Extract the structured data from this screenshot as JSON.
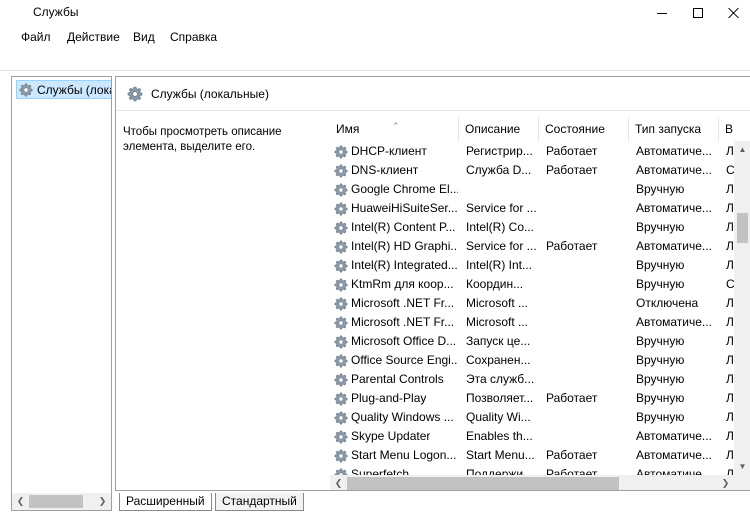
{
  "window": {
    "title": "Службы"
  },
  "menu": {
    "file": "Файл",
    "action": "Действие",
    "view": "Вид",
    "help": "Справка"
  },
  "tree": {
    "selected_label": "Службы (локальные)"
  },
  "pane": {
    "title": "Службы (локальные)",
    "description": "Чтобы просмотреть описание элемента, выделите его."
  },
  "columns": {
    "name": "Имя",
    "description": "Описание",
    "state": "Состояние",
    "startup": "Тип запуска",
    "last": "В"
  },
  "services": [
    {
      "name": "DHCP-клиент",
      "description": "Регистрир...",
      "state": "Работает",
      "startup": "Автоматиче...",
      "last": "Л"
    },
    {
      "name": "DNS-клиент",
      "description": "Служба D...",
      "state": "Работает",
      "startup": "Автоматиче...",
      "last": "С"
    },
    {
      "name": "Google Chrome El...",
      "description": "",
      "state": "",
      "startup": "Вручную",
      "last": "Л"
    },
    {
      "name": "HuaweiHiSuiteSer...",
      "description": "Service for ...",
      "state": "",
      "startup": "Автоматиче...",
      "last": "Л"
    },
    {
      "name": "Intel(R) Content P...",
      "description": "Intel(R) Co...",
      "state": "",
      "startup": "Вручную",
      "last": "Л"
    },
    {
      "name": "Intel(R) HD Graphi...",
      "description": "Service for ...",
      "state": "Работает",
      "startup": "Автоматиче...",
      "last": "Л"
    },
    {
      "name": "Intel(R) Integrated...",
      "description": "Intel(R) Int...",
      "state": "",
      "startup": "Вручную",
      "last": "Л"
    },
    {
      "name": "KtmRm для коор...",
      "description": "Координ...",
      "state": "",
      "startup": "Вручную",
      "last": "С"
    },
    {
      "name": "Microsoft .NET Fr...",
      "description": "Microsoft ...",
      "state": "",
      "startup": "Отключена",
      "last": "Л"
    },
    {
      "name": "Microsoft .NET Fr...",
      "description": "Microsoft ...",
      "state": "",
      "startup": "Автоматиче...",
      "last": "Л"
    },
    {
      "name": "Microsoft Office D...",
      "description": "Запуск це...",
      "state": "",
      "startup": "Вручную",
      "last": "Л"
    },
    {
      "name": "Office Source Engi...",
      "description": "Сохранен...",
      "state": "",
      "startup": "Вручную",
      "last": "Л"
    },
    {
      "name": "Parental Controls",
      "description": "Эта служб...",
      "state": "",
      "startup": "Вручную",
      "last": "Л"
    },
    {
      "name": "Plug-and-Play",
      "description": "Позволяет...",
      "state": "Работает",
      "startup": "Вручную",
      "last": "Л"
    },
    {
      "name": "Quality Windows ...",
      "description": "Quality Wi...",
      "state": "",
      "startup": "Вручную",
      "last": "Л"
    },
    {
      "name": "Skype Updater",
      "description": "Enables th...",
      "state": "",
      "startup": "Автоматиче...",
      "last": "Л"
    },
    {
      "name": "Start Menu Logon...",
      "description": "Start Menu...",
      "state": "Работает",
      "startup": "Автоматиче...",
      "last": "Л"
    },
    {
      "name": "Superfetch",
      "description": "Поддержи...",
      "state": "Работает",
      "startup": "Автоматиче...",
      "last": "Л"
    }
  ],
  "tabs": {
    "extended": "Расширенный",
    "standard": "Стандартный"
  },
  "icons": {
    "service": "gear-icon"
  }
}
